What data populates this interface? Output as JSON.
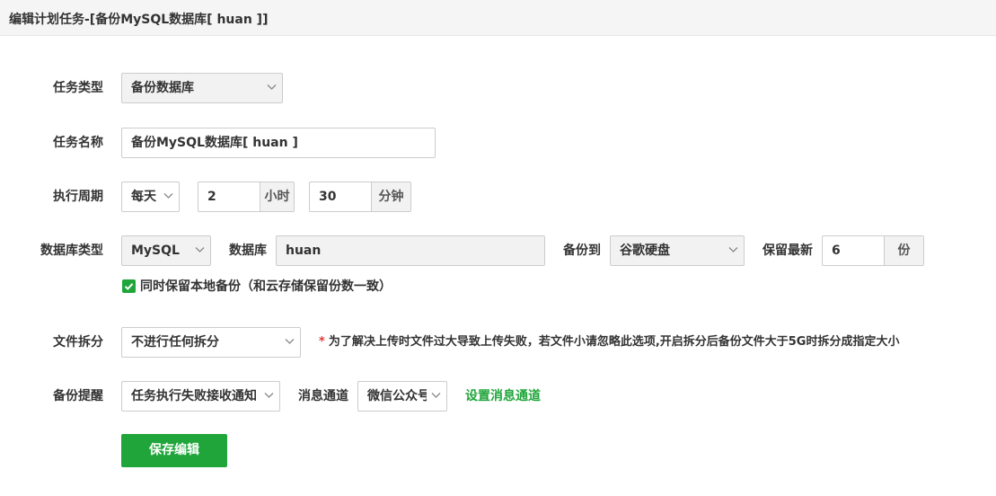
{
  "header": {
    "title": "编辑计划任务-[备份MySQL数据库[ huan ]]"
  },
  "form": {
    "task_type": {
      "label": "任务类型",
      "value": "备份数据库"
    },
    "task_name": {
      "label": "任务名称",
      "value": "备份MySQL数据库[ huan ]"
    },
    "period": {
      "label": "执行周期",
      "frequency": "每天",
      "hour": "2",
      "hour_unit": "小时",
      "minute": "30",
      "minute_unit": "分钟"
    },
    "database": {
      "type_label": "数据库类型",
      "type_value": "MySQL",
      "db_label": "数据库",
      "db_value": "huan",
      "backup_to_label": "备份到",
      "backup_to_value": "谷歌硬盘",
      "keep_label": "保留最新",
      "keep_value": "6",
      "keep_unit": "份"
    },
    "local_backup": {
      "label": "同时保留本地备份（和云存储保留份数一致）",
      "checked": true
    },
    "split": {
      "label": "文件拆分",
      "value": "不进行任何拆分",
      "note_star": "*",
      "note": "为了解决上传时文件过大导致上传失败，若文件小请忽略此选项,开启拆分后备份文件大于5G时拆分成指定大小"
    },
    "notify": {
      "label": "备份提醒",
      "value": "任务执行失败接收通知",
      "channel_label": "消息通道",
      "channel_value": "微信公众号",
      "setup_link": "设置消息通道"
    },
    "save_button": "保存编辑"
  },
  "colors": {
    "accent": "#20a53a",
    "note_star": "#e53935"
  },
  "icons": {
    "select_arrow": "chevron-down-icon",
    "checkbox": "check-icon"
  }
}
